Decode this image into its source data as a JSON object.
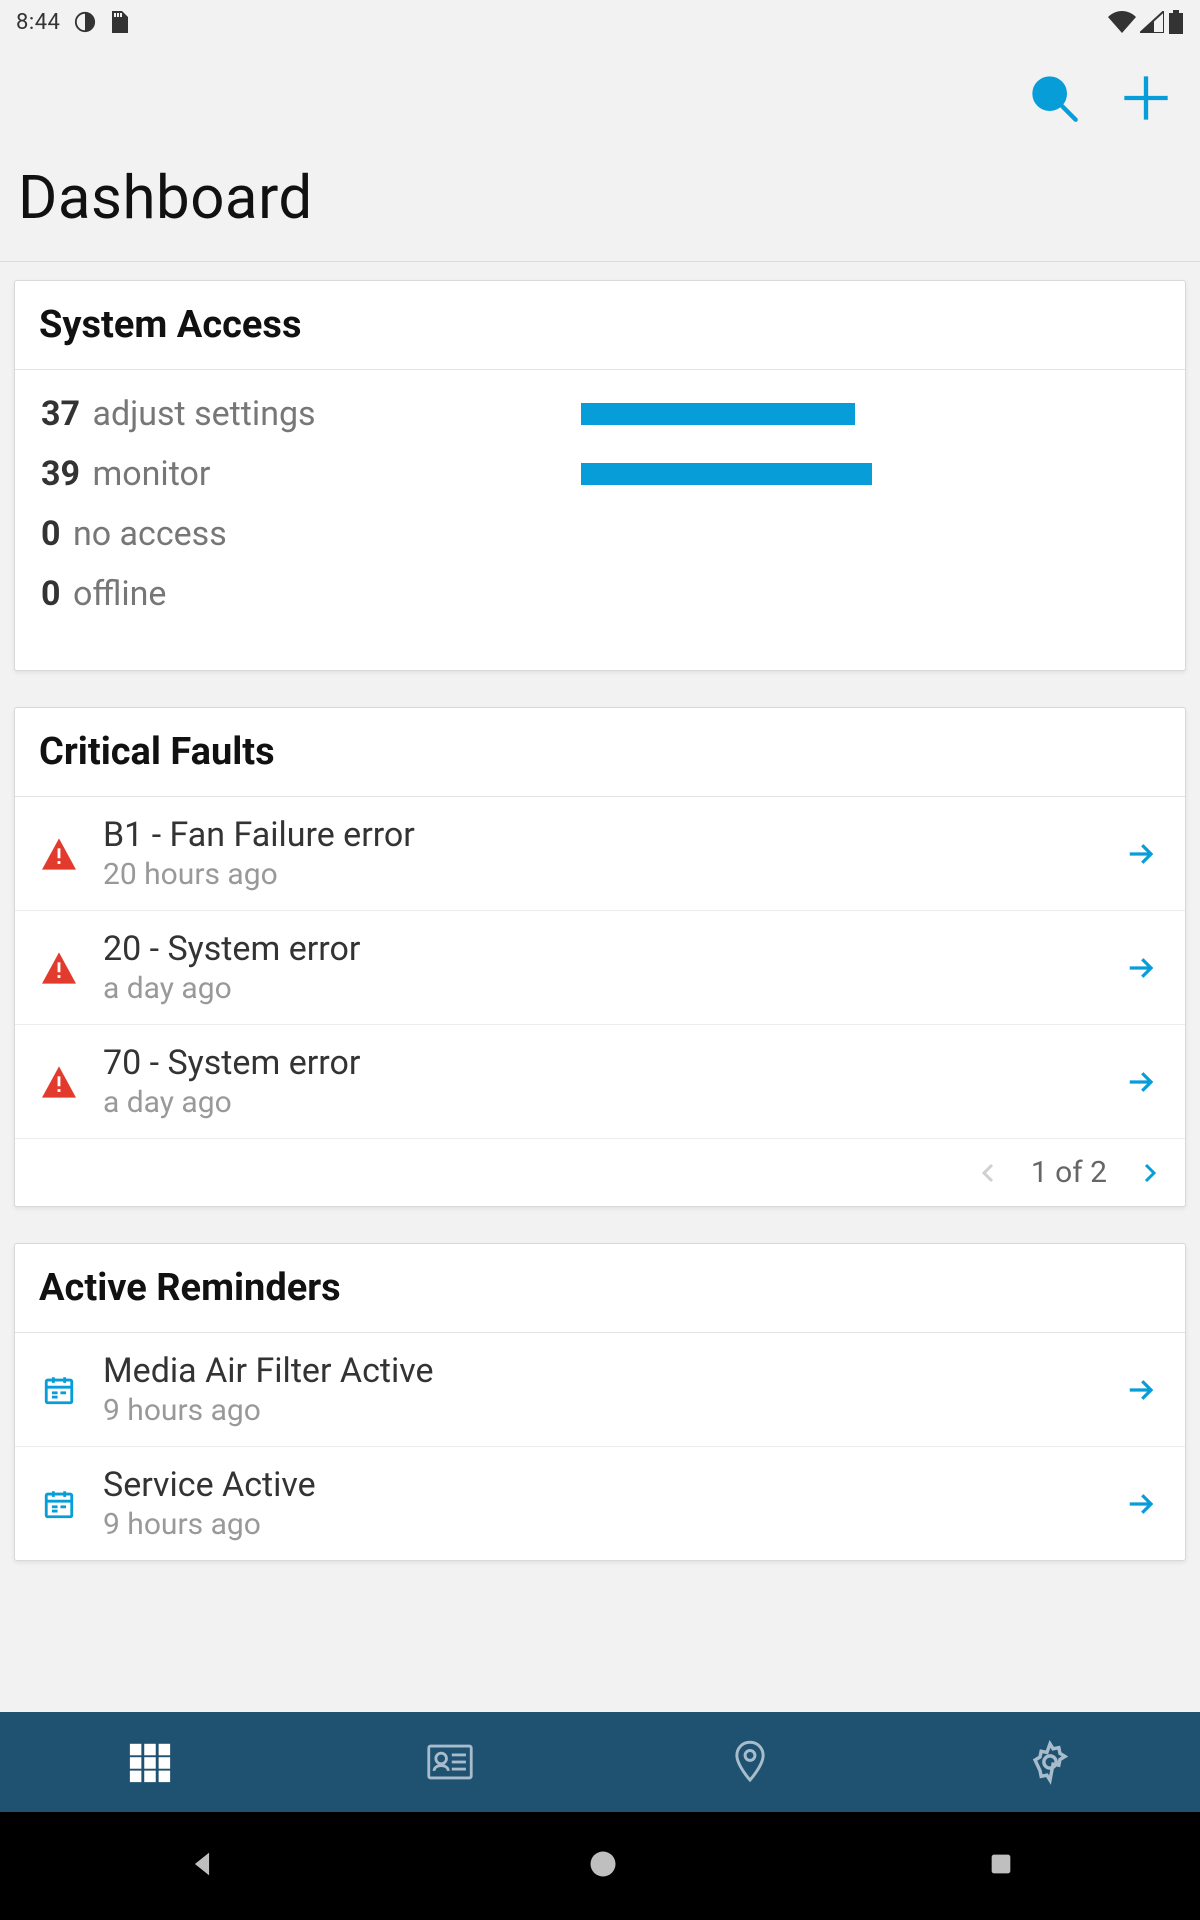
{
  "status": {
    "time": "8:44"
  },
  "header": {
    "title": "Dashboard"
  },
  "system_access": {
    "title": "System Access",
    "rows": [
      {
        "count": "37",
        "label": "adjust settings",
        "pct": 49
      },
      {
        "count": "39",
        "label": "monitor",
        "pct": 52
      },
      {
        "count": "0",
        "label": "no access",
        "pct": 0
      },
      {
        "count": "0",
        "label": "offline",
        "pct": 0
      }
    ]
  },
  "critical_faults": {
    "title": "Critical Faults",
    "items": [
      {
        "title": "B1 - Fan Failure error",
        "sub": "20 hours ago"
      },
      {
        "title": "20 - System error",
        "sub": "a day ago"
      },
      {
        "title": "70 - System error",
        "sub": "a day ago"
      }
    ],
    "pager": "1 of 2"
  },
  "active_reminders": {
    "title": "Active Reminders",
    "items": [
      {
        "title": "Media Air Filter Active",
        "sub": "9 hours ago"
      },
      {
        "title": "Service Active",
        "sub": "9 hours ago"
      }
    ]
  }
}
